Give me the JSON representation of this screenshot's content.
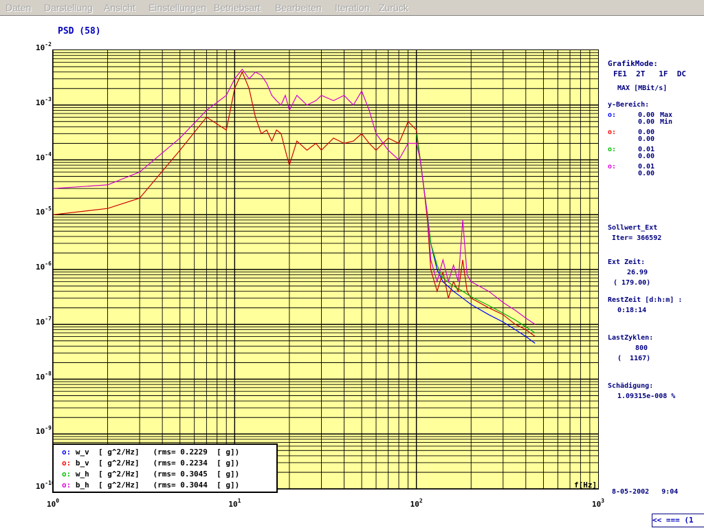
{
  "menubar": {
    "items": [
      "Daten",
      "Darstellung",
      "Ansicht",
      "Einstellungen",
      "Betriebsart",
      "Bearbeiten",
      "Iteration",
      "Zurück"
    ]
  },
  "plot": {
    "title": "PSD (58)",
    "xaxis_label": "f[Hz]",
    "legend": [
      {
        "marker": "o:",
        "text": "w_v  [ g^2/Hz]   (rms= 0.2229  [ g])",
        "color": "#0000ff"
      },
      {
        "marker": "o:",
        "text": "b_v  [ g^2/Hz]   (rms= 0.2234  [ g])",
        "color": "#ff0000"
      },
      {
        "marker": "o:",
        "text": "w_h  [ g^2/Hz]   (rms= 0.3045  [ g])",
        "color": "#00c000"
      },
      {
        "marker": "o:",
        "text": "b_h  [ g^2/Hz]   (rms= 0.3044  [ g])",
        "color": "#e000e0"
      }
    ]
  },
  "chart_data": {
    "type": "line",
    "title": "PSD (58)",
    "xlabel": "f[Hz]",
    "ylabel": "",
    "xscale": "log",
    "yscale": "log",
    "xlim": [
      1,
      1000
    ],
    "ylim": [
      1e-10,
      0.01
    ],
    "grid": true,
    "legend_position": "bottom-left",
    "x_ticks": [
      {
        "base": "10",
        "exp": "0"
      },
      {
        "base": "10",
        "exp": "1"
      },
      {
        "base": "10",
        "exp": "2"
      },
      {
        "base": "10",
        "exp": "3"
      }
    ],
    "y_ticks": [
      {
        "base": "10",
        "exp": "-2"
      },
      {
        "base": "10",
        "exp": "-3"
      },
      {
        "base": "10",
        "exp": "-4"
      },
      {
        "base": "10",
        "exp": "-5"
      },
      {
        "base": "10",
        "exp": "-6"
      },
      {
        "base": "10",
        "exp": "-7"
      },
      {
        "base": "10",
        "exp": "-8"
      },
      {
        "base": "10",
        "exp": "-9"
      },
      {
        "base": "10",
        "exp": "-10"
      }
    ],
    "series": [
      {
        "name": "w_v",
        "color": "#0000ff",
        "x": [
          100,
          105,
          110,
          115,
          120,
          130,
          140,
          160,
          180,
          200,
          250,
          300,
          350,
          400,
          450
        ],
        "y": [
          0.0003,
          0.0001,
          3e-05,
          1e-05,
          3e-06,
          1e-06,
          6e-07,
          4e-07,
          3e-07,
          2.3e-07,
          1.5e-07,
          1.1e-07,
          8e-08,
          6e-08,
          4.5e-08
        ]
      },
      {
        "name": "b_v",
        "color": "#cc0000",
        "x": [
          1,
          2,
          3,
          5,
          7,
          9,
          10,
          11,
          12,
          13,
          14,
          15,
          16,
          17,
          18,
          19,
          20,
          22,
          25,
          28,
          30,
          35,
          40,
          45,
          50,
          55,
          60,
          70,
          80,
          90,
          100,
          105,
          110,
          115,
          120,
          130,
          140,
          150,
          160,
          170,
          180,
          190,
          200,
          250,
          300,
          350,
          400,
          450
        ],
        "y": [
          1e-05,
          1.3e-05,
          2e-05,
          0.00015,
          0.0006,
          0.00035,
          0.002,
          0.004,
          0.002,
          0.0006,
          0.0003,
          0.00035,
          0.00022,
          0.00035,
          0.0003,
          0.00015,
          8e-05,
          0.00022,
          0.00015,
          0.0002,
          0.00015,
          0.00025,
          0.0002,
          0.00022,
          0.0003,
          0.0002,
          0.00015,
          0.00025,
          0.0002,
          0.0005,
          0.00035,
          0.0001,
          3e-05,
          8e-06,
          1e-06,
          4e-07,
          9e-07,
          3e-07,
          6e-07,
          4e-07,
          1.5e-06,
          4e-07,
          3e-07,
          2e-07,
          1.5e-07,
          1e-07,
          8e-08,
          6e-08
        ]
      },
      {
        "name": "w_h",
        "color": "#00b000",
        "x": [
          100,
          105,
          110,
          115,
          120,
          130,
          140,
          160,
          180,
          200,
          250,
          300,
          350,
          400,
          450
        ],
        "y": [
          0.0003,
          0.0001,
          3e-05,
          1e-05,
          3e-06,
          1.2e-06,
          7e-07,
          5e-07,
          4e-07,
          3.2e-07,
          2.2e-07,
          1.6e-07,
          1.2e-07,
          9e-08,
          7e-08
        ]
      },
      {
        "name": "b_h",
        "color": "#d000d0",
        "x": [
          1,
          2,
          3,
          5,
          7,
          9,
          10,
          11,
          12,
          13,
          14,
          15,
          16,
          17,
          18,
          19,
          20,
          22,
          25,
          28,
          30,
          35,
          40,
          45,
          50,
          55,
          60,
          70,
          80,
          90,
          100,
          105,
          110,
          115,
          120,
          130,
          140,
          150,
          160,
          170,
          180,
          190,
          200,
          250,
          300,
          350,
          400,
          450
        ],
        "y": [
          3e-05,
          3.5e-05,
          6e-05,
          0.00025,
          0.0008,
          0.0015,
          0.003,
          0.0045,
          0.003,
          0.004,
          0.0035,
          0.0025,
          0.0015,
          0.0012,
          0.001,
          0.0015,
          0.0008,
          0.0015,
          0.001,
          0.0012,
          0.0015,
          0.0012,
          0.0015,
          0.001,
          0.0018,
          0.0008,
          0.0003,
          0.00015,
          0.0001,
          0.0002,
          0.0002,
          0.0001,
          3e-05,
          1e-05,
          1.5e-06,
          6e-07,
          1.5e-06,
          6e-07,
          1.2e-06,
          6e-07,
          8e-06,
          8e-07,
          6e-07,
          4e-07,
          2.5e-07,
          1.8e-07,
          1.3e-07,
          1e-07
        ]
      }
    ]
  },
  "panel": {
    "grafikmode_label": "GrafikMode:",
    "grafikmode_value": "FE1  2T   1F  DC",
    "max_unit": "MAX [MBit/s]",
    "ybereich_label": "y-Bereich:",
    "yb_rows": [
      {
        "marker": "o:",
        "color": "#0000ff",
        "v1": "0.00",
        "v2": "0.00",
        "s1": "Max",
        "s2": "Min"
      },
      {
        "marker": "o:",
        "color": "#ff0000",
        "v1": "0.00",
        "v2": "0.00",
        "s1": "",
        "s2": ""
      },
      {
        "marker": "o:",
        "color": "#00c000",
        "v1": "0.01",
        "v2": "0.00",
        "s1": "",
        "s2": ""
      },
      {
        "marker": "o:",
        "color": "#e000e0",
        "v1": "0.01",
        "v2": "0.00",
        "s1": "",
        "s2": ""
      }
    ],
    "sollwert_label": "Sollwert_Ext",
    "iter_label": "Iter= 366592",
    "ext_zeit_label": "Ext Zeit:",
    "ext_zeit_value": "26.99",
    "ext_zeit_total": "( 179.00)",
    "restzeit_label": "RestZeit [d:h:m] :",
    "restzeit_value": "0:18:14",
    "lastzyklen_label": "LastZyklen:",
    "lastzyklen_value": "800",
    "lastzyklen_total": "(  1167)",
    "schaedigung_label": "Schädigung:",
    "schaedigung_value": "1.09315e-008 %",
    "datetime": "8-05-2002   9:04"
  },
  "nav": {
    "back_label": "<< === (1"
  }
}
